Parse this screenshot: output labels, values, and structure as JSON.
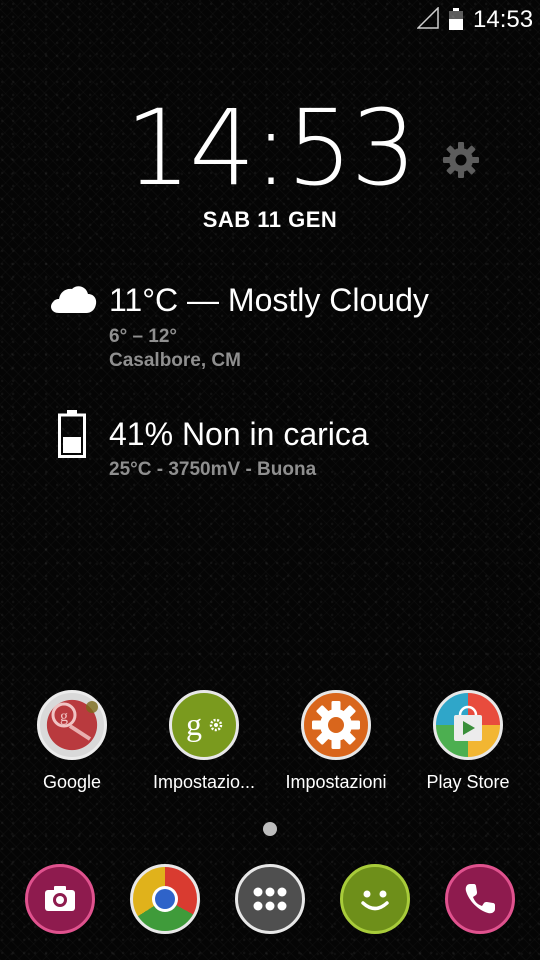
{
  "status_bar": {
    "time": "14:53"
  },
  "clock": {
    "time": "14:53",
    "date": "SAB 11 GEN"
  },
  "weather": {
    "summary": "11°C — Mostly Cloudy",
    "range": "6° – 12°",
    "location": "Casalbore, CM"
  },
  "battery": {
    "summary": "41% Non in carica",
    "details": "25°C - 3750mV - Buona"
  },
  "apps": [
    {
      "label": "Google",
      "icon": "google-search-icon"
    },
    {
      "label": "Impostazio...",
      "icon": "google-settings-icon"
    },
    {
      "label": "Impostazioni",
      "icon": "settings-gear-icon"
    },
    {
      "label": "Play Store",
      "icon": "play-store-icon"
    }
  ],
  "dock": [
    {
      "name": "camera",
      "icon": "camera-icon",
      "color": "#8e1b4e"
    },
    {
      "name": "chrome",
      "icon": "chrome-icon",
      "color": "#e0b21b"
    },
    {
      "name": "app-drawer",
      "icon": "grid-dots-icon",
      "color": "#5a5a5a"
    },
    {
      "name": "messaging",
      "icon": "smiley-icon",
      "color": "#6e8f1a"
    },
    {
      "name": "phone",
      "icon": "phone-icon",
      "color": "#8e1b4e"
    }
  ],
  "colors": {
    "google_settings_green": "#7a9a1e",
    "settings_orange": "#d9661c",
    "ring_white": "#e8e8e8"
  },
  "pager": {
    "current_page": 1,
    "pages": 1
  }
}
